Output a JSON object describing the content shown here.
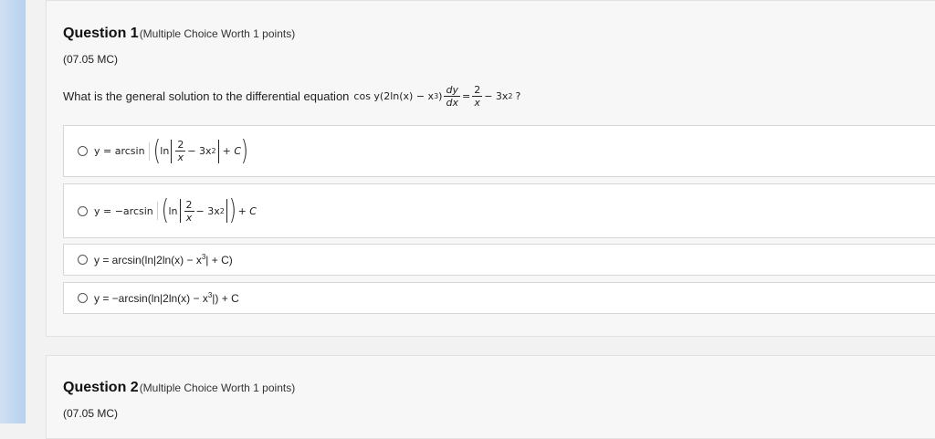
{
  "question1": {
    "title": "Question 1",
    "worth": "(Multiple Choice Worth 1 points)",
    "code": "(07.05 MC)",
    "prompt": "What is the general solution to the differential equation",
    "equation": {
      "lhs_cos": "cos y(2ln(x) − x",
      "lhs_exp": "3",
      "lhs_close": ")",
      "dy": "dy",
      "dx": "dx",
      "equals": "=",
      "two": "2",
      "x": "x",
      "minus3x": "− 3x",
      "exp2": "2",
      "qmark": "?"
    },
    "options": [
      {
        "y_eq": "y = arcsin",
        "ln": "ln",
        "num": "2",
        "den": "x",
        "minus3x": "− 3x",
        "exp": "2",
        "plusC": "+ C"
      },
      {
        "y_eq": "y = −arcsin",
        "ln": "ln",
        "num": "2",
        "den": "x",
        "minus3x": "− 3x",
        "exp": "2",
        "plusC": "+ C"
      },
      {
        "text_a": "y = arcsin(ln|2ln(x) − x",
        "exp": "3",
        "text_b": "| + C)"
      },
      {
        "text_a": "y = −arcsin(ln|2ln(x) − x",
        "exp": "3",
        "text_b": "|) + C"
      }
    ]
  },
  "question2": {
    "title": "Question 2",
    "worth": "(Multiple Choice Worth 1 points)",
    "code": "(07.05 MC)"
  }
}
